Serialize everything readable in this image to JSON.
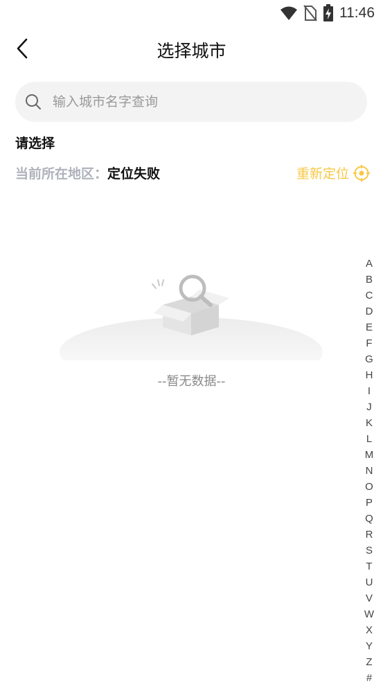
{
  "status_bar": {
    "time": "11:46",
    "icons": [
      "wifi-icon",
      "no-sim-icon",
      "battery-charging-icon"
    ]
  },
  "header": {
    "title": "选择城市",
    "back_icon": "chevron-left-icon"
  },
  "search": {
    "placeholder": "输入城市名字查询",
    "value": ""
  },
  "section": {
    "title": "请选择"
  },
  "location": {
    "label": "当前所在地区：",
    "value": "定位失败",
    "relocate_label": "重新定位",
    "relocate_icon": "locate-icon"
  },
  "empty_state": {
    "illustration": "empty-box-icon",
    "text": "--暂无数据--"
  },
  "alphabet_index": [
    "A",
    "B",
    "C",
    "D",
    "E",
    "F",
    "G",
    "H",
    "I",
    "J",
    "K",
    "L",
    "M",
    "N",
    "O",
    "P",
    "Q",
    "R",
    "S",
    "T",
    "U",
    "V",
    "W",
    "X",
    "Y",
    "Z",
    "#"
  ],
  "colors": {
    "accent": "#f7c846",
    "label_gray": "#aeb2bb",
    "search_bg": "#f3f3f3"
  }
}
